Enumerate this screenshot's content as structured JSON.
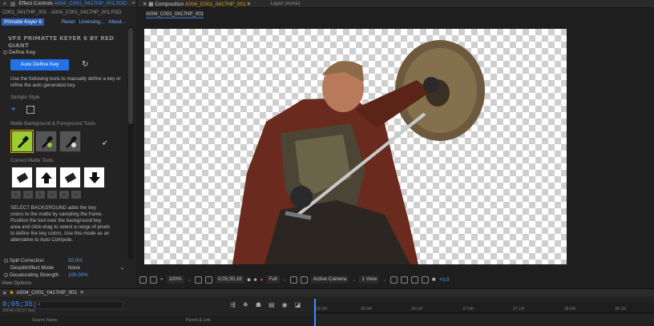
{
  "effect_panel": {
    "tab_prefix": "Effect Controls",
    "tab_file": "A004_C001_0417HP_001.R3D",
    "layer_line": "C001_0417HP_001 · A004_C001_0417HP_001.R3D",
    "effect_name": "Primatte Keyer 6",
    "links": [
      "Reset",
      "Licensing...",
      "About..."
    ],
    "plugin_title": "VFX PRIMATTE KEYER 6 BY RED GIANT",
    "define_key_label": "Define Key",
    "auto_define_button": "Auto Define Key",
    "intro_text": "Use the following tools to manually define a key or refine the auto generated key.",
    "sample_style_label": "Sample Style",
    "matte_tools_label": "Matte Background & Foreground Tools",
    "correct_tools_label": "Correct Matte Tools",
    "help_text": "SELECT BACKGROUND adds the key colors to the matte by sampling the frame. Position the tool over the background key area and click-drag to select a range of pixels to define the key colors. Use this mode as an alternative to Auto Compute.",
    "params": [
      {
        "label": "Spill Correction",
        "value": "50.0%"
      },
      {
        "label": "Despill/Affect Mode",
        "value": "None"
      },
      {
        "label": "Desaturating Strength",
        "value": "100.00%"
      }
    ],
    "view_options": "View Options"
  },
  "composition": {
    "tab_prefix": "Composition",
    "tab_name": "A004_C001_0417HP_001",
    "layer_tab": "Layer (none)",
    "subtab": "A004_C001_0417HP_001",
    "toolbar": {
      "zoom": "100%",
      "timecode": "0;05;35;16",
      "resolution": "Full",
      "camera": "Active Camera",
      "views": "1 View",
      "exposure": "+0.0"
    }
  },
  "timeline": {
    "tab": "A004_C001_0417HP_001",
    "timecode": "0;05;35;16",
    "fps": "09648 (29.97 fps)",
    "ruler_ticks": [
      "05:00f",
      "36:04f",
      "36:19f",
      "37:04f",
      "37:19f",
      "38:04f",
      "38:19f"
    ],
    "columns": [
      "Source Name",
      "Parent & Link"
    ]
  },
  "colors": {
    "accent": "#2371e7",
    "selected_tool": "#9acd32",
    "timecode": "#3d8eff"
  }
}
